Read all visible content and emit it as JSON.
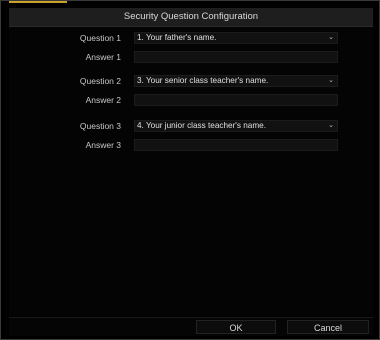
{
  "dialog": {
    "title": "Security Question Configuration"
  },
  "questions": [
    {
      "label": "Question 1",
      "selected": "1. Your father's name."
    },
    {
      "label": "Question 2",
      "selected": "3. Your senior class teacher's name."
    },
    {
      "label": "Question 3",
      "selected": "4. Your junior class teacher's name."
    }
  ],
  "answers": [
    {
      "label": "Answer 1",
      "value": ""
    },
    {
      "label": "Answer 2",
      "value": ""
    },
    {
      "label": "Answer 3",
      "value": ""
    }
  ],
  "buttons": {
    "ok": "OK",
    "cancel": "Cancel"
  },
  "icons": {
    "dropdown": "chevron-down-icon"
  },
  "colors": {
    "accent": "#c9a227",
    "background": "#000000",
    "title_bar": "#1e1e1e",
    "text": "#d8d8d8"
  }
}
